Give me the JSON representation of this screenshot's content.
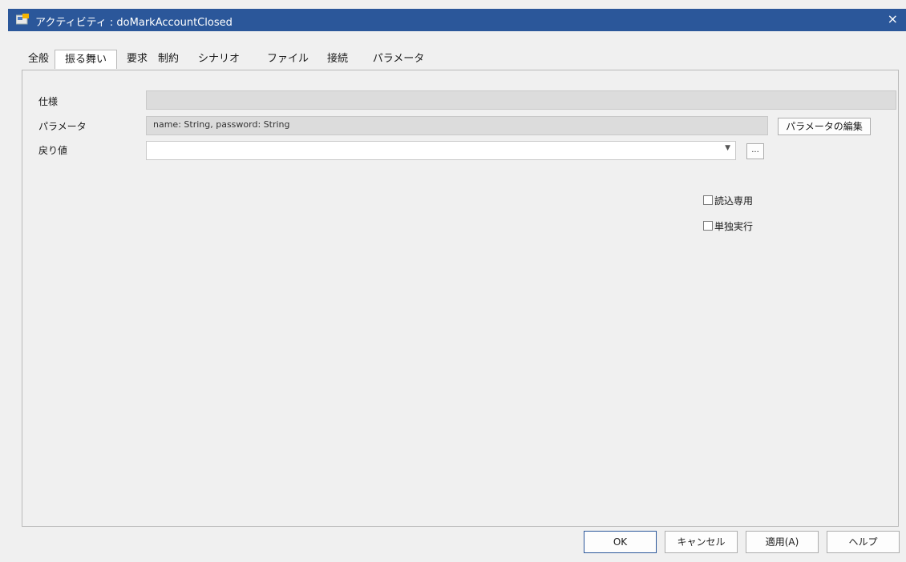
{
  "window": {
    "title": "アクティビティ : doMarkAccountClosed",
    "close": "×"
  },
  "tabs": [
    "全般",
    "振る舞い",
    "要求",
    "制約",
    "シナリオ",
    "ファイル",
    "接続",
    "パラメータ"
  ],
  "active_tab": "振る舞い",
  "form": {
    "spec_label": "仕様",
    "spec_value": "",
    "params_label": "パラメータ",
    "params_value": "name: String, password: String",
    "edit_params_button": "パラメータの編集",
    "return_label": "戻り値",
    "return_value": "",
    "return_browse_button": "...",
    "readonly_label": "読込専用",
    "standalone_label": "単独実行"
  },
  "footer": {
    "ok": "OK",
    "cancel": "キャンセル",
    "apply": "適用(A)",
    "help": "ヘルプ"
  },
  "colors": {
    "titlebar": "#2b579a",
    "background": "#f0f0f0"
  }
}
